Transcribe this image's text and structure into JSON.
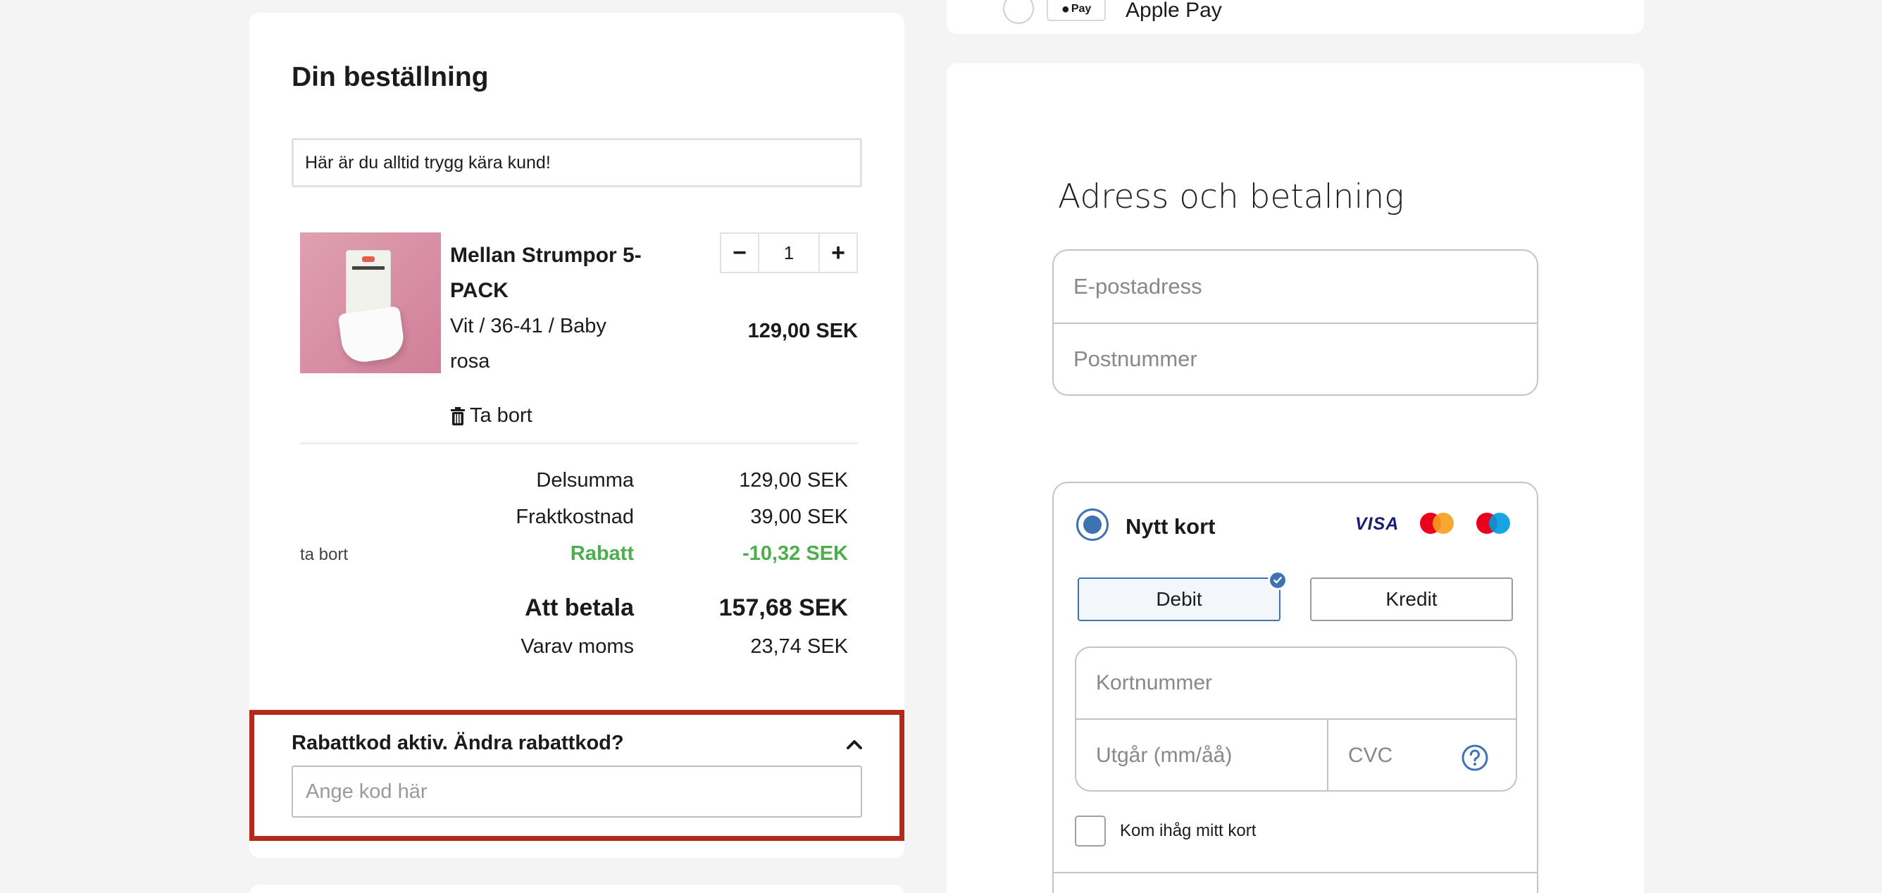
{
  "order": {
    "title": "Din beställning",
    "trust_message": "Här är du alltid trygg kära kund!",
    "product": {
      "name": "Mellan Strumpor 5-PACK",
      "variant": "Vit / 36-41 / Baby rosa",
      "quantity": "1",
      "price": "129,00 SEK",
      "remove_label": "Ta bort",
      "qty_minus": "−",
      "qty_plus": "+"
    },
    "summary": {
      "subtotal_label": "Delsumma",
      "subtotal_value": "129,00 SEK",
      "shipping_label": "Fraktkostnad",
      "shipping_value": "39,00 SEK",
      "discount_remove": "ta bort",
      "discount_label": "Rabatt",
      "discount_value": "-10,32 SEK",
      "total_label": "Att betala",
      "total_value": "157,68 SEK",
      "vat_label": "Varav moms",
      "vat_value": "23,74 SEK"
    },
    "discount_code": {
      "title": "Rabattkod aktiv. Ändra rabattkod?",
      "placeholder": "Ange kod här",
      "value": ""
    }
  },
  "payment": {
    "apple_pay_badge": "Pay",
    "apple_pay_label": "Apple Pay",
    "title": "Adress och betalning",
    "email_placeholder": "E-postadress",
    "postcode_placeholder": "Postnummer",
    "card": {
      "label": "Nytt kort",
      "visa": "VISA",
      "debit": "Debit",
      "credit": "Kredit",
      "number_placeholder": "Kortnummer",
      "expiry_placeholder": "Utgår (mm/åå)",
      "cvc_placeholder": "CVC",
      "remember_label": "Kom ihåg mitt kort"
    }
  },
  "colors": {
    "accent_blue": "#3e72b2",
    "discount_green": "#4cae4c",
    "highlight_red": "#b3291b"
  }
}
